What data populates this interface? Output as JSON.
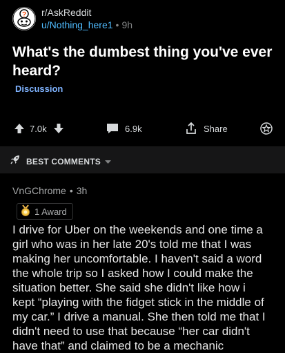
{
  "post": {
    "subreddit": "r/AskReddit",
    "author": "u/Nothing_here1",
    "time": "9h",
    "separator": "•",
    "title": "What's the dumbest thing you've ever heard?",
    "flair": "Discussion",
    "flair_color": "#7fb3ff"
  },
  "actions": {
    "votes": "7.0k",
    "comments": "6.9k",
    "share_label": "Share"
  },
  "sort": {
    "label": "BEST COMMENTS"
  },
  "comment": {
    "author": "VnGChrome",
    "separator": "•",
    "time": "3h",
    "award_label": "1 Award",
    "body_lines": [
      "I drive for Uber on the weekends and one time a",
      "girl who was in her late 20's told me that I was",
      "making her uncomfortable. I haven't said a word",
      "the whole trip so I asked how I could make the",
      "situation better. She said she didn't like how i",
      "kept “playing with the fidget stick in the middle of",
      "my car.” I drive a manual. She then told me that I",
      "didn't need to use that because “her car didn't",
      "have that” and claimed to be a mechanic"
    ]
  },
  "colors": {
    "background": "#000000",
    "author_link": "#4fbcff",
    "title": "#ffffff",
    "sort_bar": "#161617"
  },
  "icons": [
    "subreddit-avatar-icon",
    "upvote-icon",
    "downvote-icon",
    "comment-icon",
    "share-icon",
    "award-icon",
    "rocket-icon",
    "chevron-down-icon",
    "award-medal-icon"
  ]
}
